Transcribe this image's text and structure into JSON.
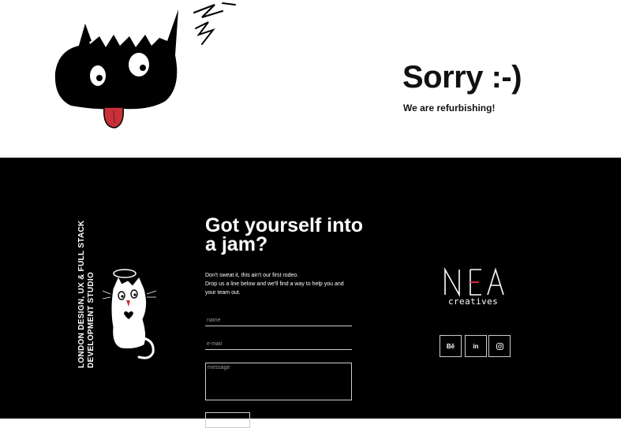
{
  "hero": {
    "title": "Sorry :-)",
    "subtitle": "We are refurbishing!"
  },
  "studio": {
    "tagline_line1": "London design, UX & full stack",
    "tagline_line2": "development studio"
  },
  "contact": {
    "title": "Got yourself into a jam?",
    "desc_line1": "Don't sweat it, this ain't our first rodeo.",
    "desc_line2": "Drop us a line below and we'll find a way to help you and your team out.",
    "name_placeholder": "name",
    "email_placeholder": "e-mail",
    "message_placeholder": "message"
  },
  "logo": {
    "wordmark": "creatives"
  },
  "social": {
    "behance": "Bē",
    "linkedin": "in"
  },
  "colors": {
    "background": "#ffffff",
    "footer_background": "#000000",
    "accent_red": "#c8313a"
  },
  "icons": [
    "cat-devil-illustration",
    "cat-angel-illustration",
    "behance-icon",
    "linkedin-icon",
    "instagram-icon"
  ]
}
